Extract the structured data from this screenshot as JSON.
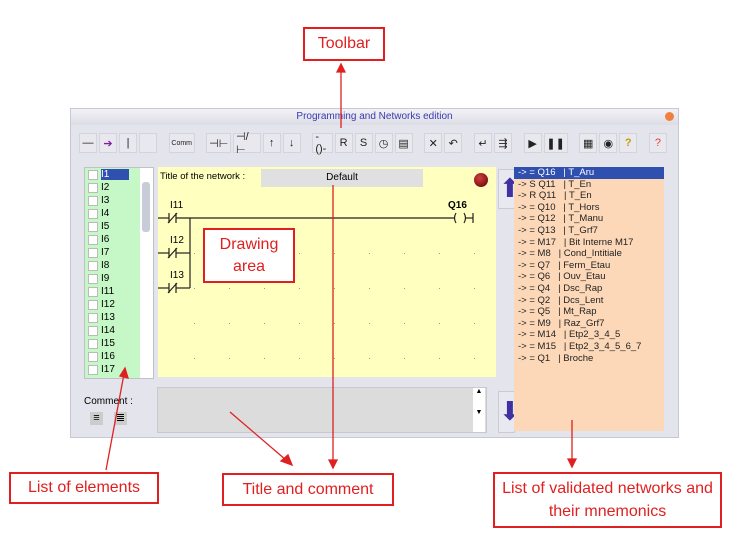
{
  "window": {
    "title": "Programming and Networks edition"
  },
  "toolbar": {
    "buttons": [
      {
        "name": "horizontal-line",
        "glyph": "—"
      },
      {
        "name": "arrow",
        "glyph": "➔"
      },
      {
        "name": "vertical-line",
        "glyph": "|"
      },
      {
        "name": "blank",
        "glyph": ""
      },
      {
        "name": "comment",
        "glyph": "Comm"
      },
      {
        "name": "contact-no",
        "glyph": "⊣⊢"
      },
      {
        "name": "contact-nc",
        "glyph": "⊣/⊢"
      },
      {
        "name": "rising-edge",
        "glyph": "↑"
      },
      {
        "name": "falling-edge",
        "glyph": "↓"
      },
      {
        "name": "coil",
        "glyph": "-()-"
      },
      {
        "name": "reset",
        "glyph": "R"
      },
      {
        "name": "set",
        "glyph": "S"
      },
      {
        "name": "timer",
        "glyph": "◷"
      },
      {
        "name": "counter",
        "glyph": "▤"
      },
      {
        "name": "delete",
        "glyph": "✕"
      },
      {
        "name": "undo",
        "glyph": "↶"
      },
      {
        "name": "enter",
        "glyph": "↵"
      },
      {
        "name": "insert",
        "glyph": "⇶"
      },
      {
        "name": "run",
        "glyph": "▶"
      },
      {
        "name": "pause",
        "glyph": "❚❚"
      },
      {
        "name": "grid",
        "glyph": "▦"
      },
      {
        "name": "view",
        "glyph": "◉"
      },
      {
        "name": "help",
        "glyph": "?"
      },
      {
        "name": "exit",
        "glyph": "?"
      }
    ]
  },
  "elements": [
    "I1",
    "I2",
    "I3",
    "I4",
    "I5",
    "I6",
    "I7",
    "I8",
    "I9",
    "I11",
    "I12",
    "I13",
    "I14",
    "I15",
    "I16",
    "I17"
  ],
  "drawing": {
    "title_label": "Title of the network :",
    "title_value": "Default",
    "contacts": [
      "I11",
      "I12",
      "I13"
    ],
    "coil": "Q16"
  },
  "comment": {
    "label": "Comment :",
    "value": ""
  },
  "networks": [
    "-> = Q16   | T_Aru",
    "-> S Q11   | T_En",
    "-> R Q11   | T_En",
    "-> = Q10   | T_Hors",
    "-> = Q12   | T_Manu",
    "-> = Q13   | T_Grf7",
    "-> = M17   | Bit Interne M17",
    "-> = M8   | Cond_Intitiale",
    "-> = Q7   | Ferm_Etau",
    "-> = Q6   | Ouv_Etau",
    "-> = Q4   | Dsc_Rap",
    "-> = Q2   | Dcs_Lent",
    "-> = Q5   | Mt_Rap",
    "-> = M9   | Raz_Grf7",
    "-> = M14   | Etp2_3_4_5",
    "-> = M15   | Etp2_3_4_5_6_7",
    "-> = Q1   | Broche"
  ],
  "annotations": {
    "toolbar": "Toolbar",
    "drawing": "Drawing area",
    "elements": "List of elements",
    "title_comment": "Title and comment",
    "networks": "List of validated networks and their mnemonics"
  },
  "colors": {
    "annotation": "#e02020",
    "selection": "#3050b0",
    "elements_bg": "#c6f7c6",
    "drawing_bg": "#ffffc0",
    "networks_bg": "#fcd8b8"
  }
}
